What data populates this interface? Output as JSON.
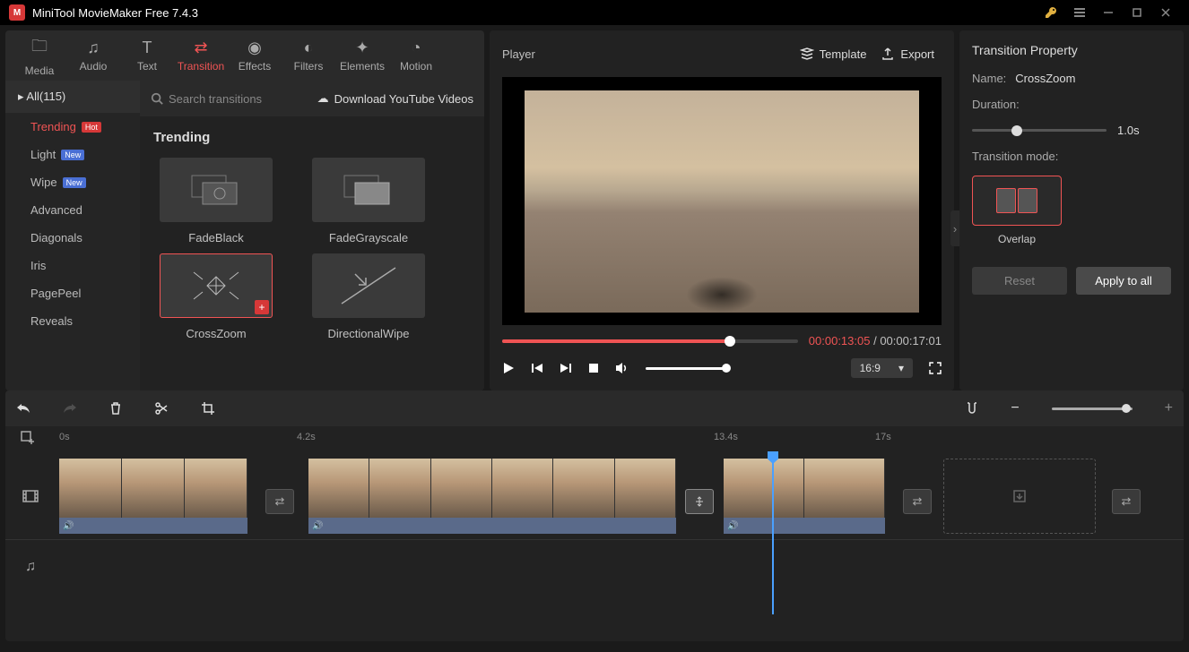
{
  "titlebar": {
    "title": "MiniTool MovieMaker Free 7.4.3"
  },
  "toolbar": {
    "items": [
      {
        "label": "Media"
      },
      {
        "label": "Audio"
      },
      {
        "label": "Text"
      },
      {
        "label": "Transition"
      },
      {
        "label": "Effects"
      },
      {
        "label": "Filters"
      },
      {
        "label": "Elements"
      },
      {
        "label": "Motion"
      }
    ]
  },
  "categories": {
    "head": "All(115)",
    "items": [
      {
        "label": "Trending",
        "badge": "Hot",
        "badgeClass": "hot"
      },
      {
        "label": "Light",
        "badge": "New",
        "badgeClass": "new"
      },
      {
        "label": "Wipe",
        "badge": "New",
        "badgeClass": "new"
      },
      {
        "label": "Advanced"
      },
      {
        "label": "Diagonals"
      },
      {
        "label": "Iris"
      },
      {
        "label": "PagePeel"
      },
      {
        "label": "Reveals"
      }
    ]
  },
  "browser": {
    "search_placeholder": "Search transitions",
    "yt_link": "Download YouTube Videos",
    "section_title": "Trending",
    "items": [
      {
        "label": "FadeBlack"
      },
      {
        "label": "FadeGrayscale"
      },
      {
        "label": "CrossZoom"
      },
      {
        "label": "DirectionalWipe"
      }
    ]
  },
  "player": {
    "title": "Player",
    "template_btn": "Template",
    "export_btn": "Export",
    "current_time": "00:00:13:05",
    "total_time": "00:00:17:01",
    "aspect": "16:9"
  },
  "props": {
    "title": "Transition Property",
    "name_label": "Name:",
    "name_value": "CrossZoom",
    "duration_label": "Duration:",
    "duration_value": "1.0s",
    "mode_label": "Transition mode:",
    "mode_value": "Overlap",
    "reset_btn": "Reset",
    "apply_btn": "Apply to all"
  },
  "timeline": {
    "ticks": [
      "0s",
      "4.2s",
      "13.4s",
      "17s"
    ]
  }
}
